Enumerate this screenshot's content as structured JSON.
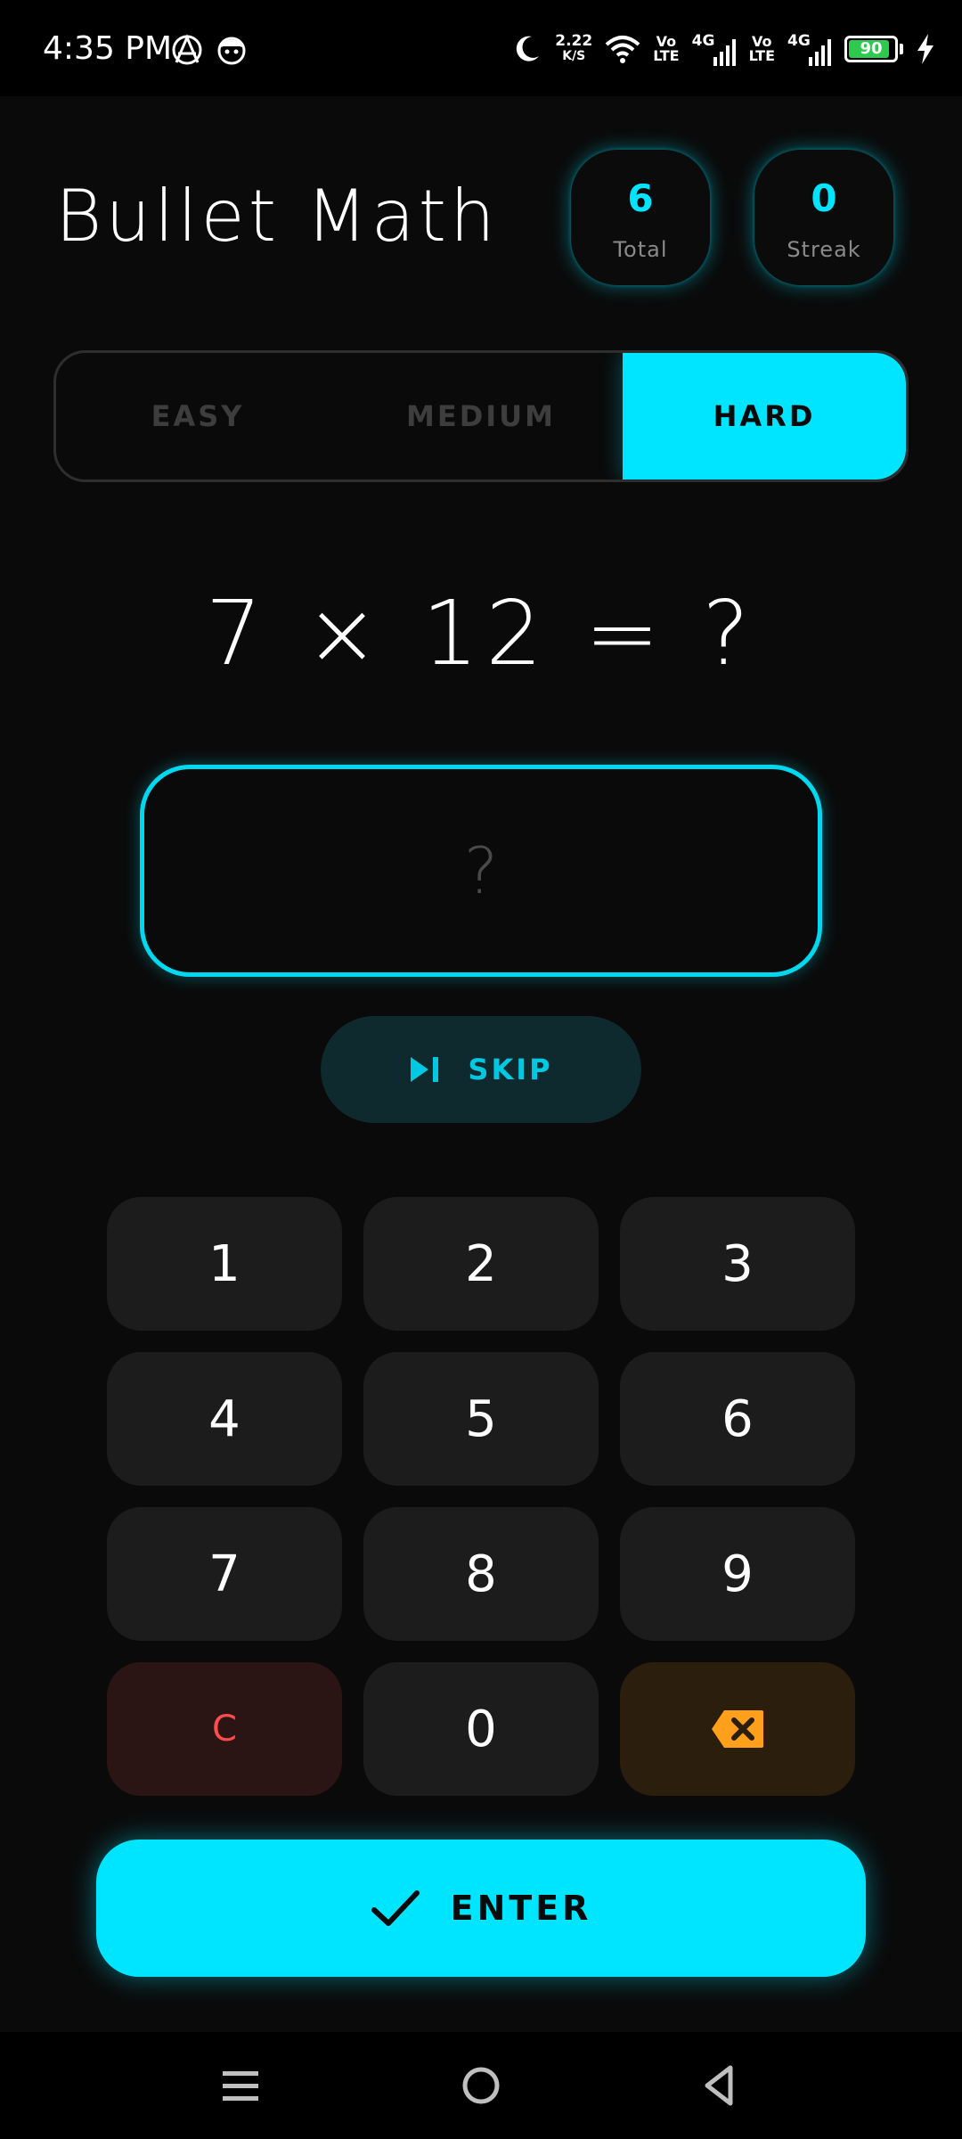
{
  "status_bar": {
    "time": "4:35 PM",
    "net_speed_value": "2.22",
    "net_speed_unit": "K/S",
    "volte_1_top": "Vo",
    "volte_1_bottom": "LTE",
    "network_1": "4G",
    "volte_2_top": "Vo",
    "volte_2_bottom": "LTE",
    "network_2": "4G",
    "battery_level": "90",
    "battery_fraction": 0.9,
    "left_icons": [
      "anarchy-icon",
      "face-icon"
    ],
    "right_icons": [
      "moon-icon",
      "wifi-icon",
      "signal-icon",
      "signal-icon",
      "charging-bolt-icon"
    ]
  },
  "header": {
    "title": "Bullet Math",
    "stats": [
      {
        "value": "6",
        "label": "Total"
      },
      {
        "value": "0",
        "label": "Streak"
      }
    ]
  },
  "difficulty": {
    "options": [
      "EASY",
      "MEDIUM",
      "HARD"
    ],
    "selected": "HARD"
  },
  "question": {
    "text": "7 × 12 = ?"
  },
  "answer": {
    "placeholder": "?",
    "value": ""
  },
  "skip": {
    "label": "SKIP",
    "icon": "skip-next-icon"
  },
  "keypad": {
    "keys": [
      "1",
      "2",
      "3",
      "4",
      "5",
      "6",
      "7",
      "8",
      "9",
      "C",
      "0"
    ],
    "backspace_icon": "backspace-icon"
  },
  "enter": {
    "label": "ENTER",
    "icon": "check-icon"
  },
  "nav": {
    "icons": [
      "menu-icon",
      "home-icon",
      "back-icon"
    ]
  },
  "colors": {
    "background": "#0a0a0a",
    "accent": "#00e5ff",
    "key_bg": "#1c1c1c",
    "clear_color": "#ff4d4d",
    "backspace_color": "#ff9f1a",
    "battery_green": "#2ec94f"
  }
}
